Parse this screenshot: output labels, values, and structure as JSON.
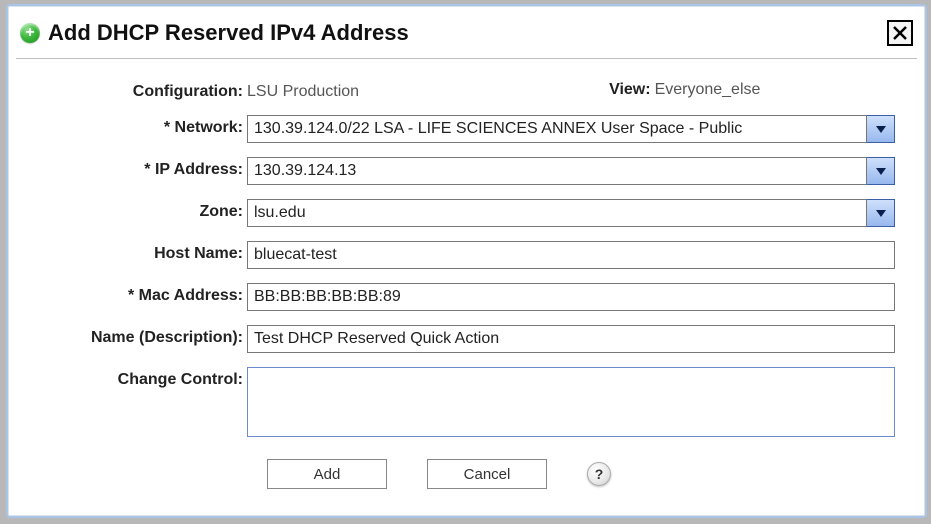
{
  "title": "Add DHCP Reserved IPv4 Address",
  "labels": {
    "configuration": "Configuration:",
    "view": "View:",
    "network": "* Network:",
    "ip_address": "* IP Address:",
    "zone": "Zone:",
    "host_name": "Host Name:",
    "mac_address": "* Mac Address:",
    "name_description": "Name (Description):",
    "change_control": "Change Control:"
  },
  "values": {
    "configuration": "LSU Production",
    "view": "Everyone_else",
    "network": "130.39.124.0/22 LSA - LIFE SCIENCES ANNEX User Space - Public",
    "ip_address": "130.39.124.13",
    "zone": "lsu.edu",
    "host_name": "bluecat-test",
    "mac_address": "BB:BB:BB:BB:BB:89",
    "name_description": "Test DHCP Reserved Quick Action",
    "change_control": ""
  },
  "buttons": {
    "add": "Add",
    "cancel": "Cancel",
    "help": "?"
  }
}
